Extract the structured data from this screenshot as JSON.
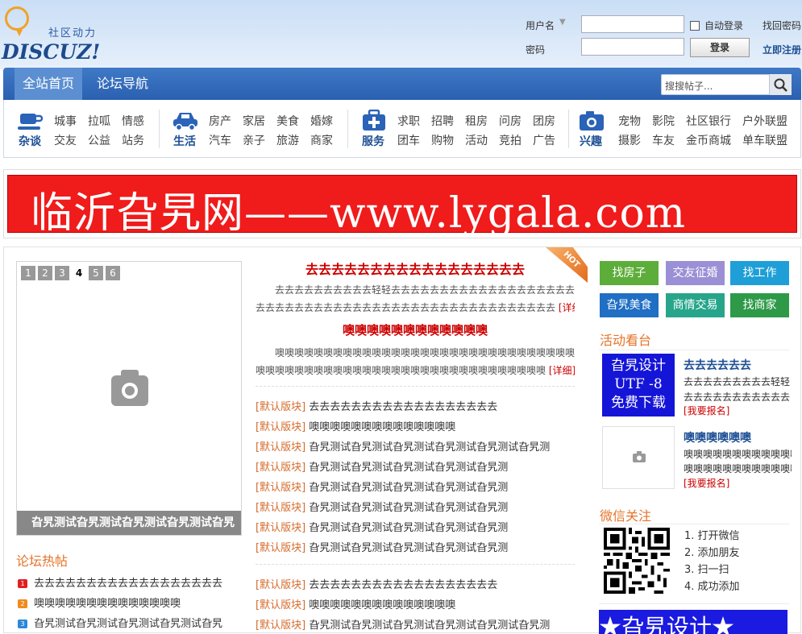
{
  "header": {
    "logo_cn": "社区动力",
    "logo_en": "DISCUZ!",
    "login": {
      "username_label": "用户名",
      "password_label": "密码",
      "auto_login": "自动登录",
      "login_button": "登录",
      "find_password": "找回密码",
      "register": "立即注册"
    }
  },
  "nav": {
    "items": [
      "全站首页",
      "论坛导航"
    ],
    "search_placeholder": "搜搜帖子..."
  },
  "subnav": {
    "groups": [
      {
        "title": "杂谈",
        "icon": "cup-icon",
        "links": [
          "城事",
          "拉呱",
          "情感",
          "交友",
          "公益",
          "站务"
        ]
      },
      {
        "title": "生活",
        "icon": "car-icon",
        "links": [
          "房产",
          "家居",
          "美食",
          "婚嫁",
          "汽车",
          "亲子",
          "旅游",
          "商家"
        ]
      },
      {
        "title": "服务",
        "icon": "medkit-icon",
        "links": [
          "求职",
          "招聘",
          "租房",
          "问房",
          "团房",
          "团车",
          "购物",
          "活动",
          "竞拍",
          "广告"
        ]
      },
      {
        "title": "兴趣",
        "icon": "camera-icon",
        "links": [
          "宠物",
          "影院",
          "社区银行",
          "户外联盟",
          "摄影",
          "车友",
          "金币商城",
          "单车联盟"
        ]
      }
    ]
  },
  "banner": {
    "text": "临沂旮旯网——www.lygala.com"
  },
  "slideshow": {
    "pages": [
      "1",
      "2",
      "3",
      "4",
      "5",
      "6"
    ],
    "active": "4",
    "caption": "旮旯测试旮旯测试旮旯测试旮旯测试旮旯"
  },
  "hot_posts": {
    "title": "论坛热帖",
    "items": [
      {
        "rank": "1",
        "color": "#e02020",
        "text": "去去去去去去去去去去去去去去去去去去"
      },
      {
        "rank": "2",
        "color": "#f08a1e",
        "text": "噢噢噢噢噢噢噢噢噢噢噢噢噢噢"
      },
      {
        "rank": "3",
        "color": "#2d87d8",
        "text": "旮旯测试旮旯测试旮旯测试旮旯测试旮旯"
      }
    ]
  },
  "headlines": [
    {
      "title": "去去去去去去去去去去去去去去去去去",
      "summary1": "去去去去去去去去去去轻轻去去去去去去去去去去去去去去去去去去去",
      "summary2": "去去去去去去去去去去去去去去去去去去去去去去去去去去去去去去去",
      "detail": "[详细]"
    },
    {
      "title": "噢噢噢噢噢噢噢噢噢噢噢噢",
      "summary1": "噢噢噢噢噢噢噢噢噢噢噢噢噢噢噢噢噢噢噢噢噢噢噢噢噢噢噢噢噢噢噢",
      "summary2": "噢噢噢噢噢噢噢噢噢噢噢噢噢噢噢噢噢噢噢噢噢噢噢噢噢噢噢噢噢噢",
      "detail": "[详细]"
    }
  ],
  "hot_badge": "HOT",
  "list_a": [
    {
      "tag": "[默认版块]",
      "text": "去去去去去去去去去去去去去去去去去去"
    },
    {
      "tag": "[默认版块]",
      "text": "噢噢噢噢噢噢噢噢噢噢噢噢噢噢"
    },
    {
      "tag": "[默认版块]",
      "text": "旮旯测试旮旯测试旮旯测试旮旯测试旮旯测试旮旯测"
    },
    {
      "tag": "[默认版块]",
      "text": "旮旯测试旮旯测试旮旯测试旮旯测试旮旯测"
    },
    {
      "tag": "[默认版块]",
      "text": "旮旯测试旮旯测试旮旯测试旮旯测试旮旯测"
    },
    {
      "tag": "[默认版块]",
      "text": "旮旯测试旮旯测试旮旯测试旮旯测试旮旯测"
    },
    {
      "tag": "[默认版块]",
      "text": "旮旯测试旮旯测试旮旯测试旮旯测试旮旯测"
    },
    {
      "tag": "[默认版块]",
      "text": "旮旯测试旮旯测试旮旯测试旮旯测试旮旯测"
    }
  ],
  "list_b": [
    {
      "tag": "[默认版块]",
      "text": "去去去去去去去去去去去去去去去去去去"
    },
    {
      "tag": "[默认版块]",
      "text": "噢噢噢噢噢噢噢噢噢噢噢噢噢噢"
    },
    {
      "tag": "[默认版块]",
      "text": "旮旯测试旮旯测试旮旯测试旮旯测试旮旯测试旮旯测"
    }
  ],
  "quick_buttons": [
    {
      "label": "找房子",
      "color": "#5dad3a"
    },
    {
      "label": "交友征婚",
      "color": "#9b8fd6"
    },
    {
      "label": "找工作",
      "color": "#1f9fd7"
    },
    {
      "label": "旮旯美食",
      "color": "#1f6fc4"
    },
    {
      "label": "商情交易",
      "color": "#27a58b"
    },
    {
      "label": "找商家",
      "color": "#2e9a48"
    }
  ],
  "activity": {
    "title": "活动看台",
    "items": [
      {
        "img_lines": [
          "旮旯设计",
          "UTF -8",
          "免费下载"
        ],
        "title": "去去去去去去",
        "line1": "去去去去去去去去去轻轻",
        "line2": "去去去去去去去去去去去",
        "signup": "[我要报名]"
      },
      {
        "title": "噢噢噢噢噢噢",
        "line1": "噢噢噢噢噢噢噢噢噢噢噢噢",
        "line2": "噢噢噢噢噢噢噢噢噢噢噢噢",
        "signup": "[我要报名]"
      }
    ]
  },
  "wechat": {
    "title": "微信关注",
    "steps": [
      "1.  打开微信",
      "2.  添加朋友",
      "3.  扫一扫",
      "4.  成功添加"
    ]
  },
  "bottom_banner": "★旮旯设计★"
}
